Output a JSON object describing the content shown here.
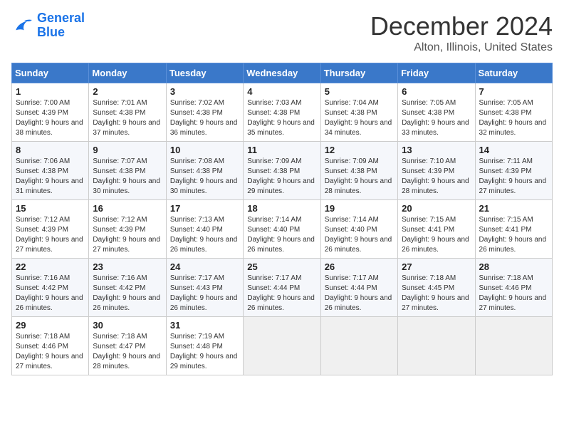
{
  "logo": {
    "line1": "General",
    "line2": "Blue"
  },
  "title": "December 2024",
  "location": "Alton, Illinois, United States",
  "days_header": [
    "Sunday",
    "Monday",
    "Tuesday",
    "Wednesday",
    "Thursday",
    "Friday",
    "Saturday"
  ],
  "weeks": [
    [
      {
        "day": 1,
        "sunrise": "7:00 AM",
        "sunset": "4:39 PM",
        "daylight": "9 hours and 38 minutes."
      },
      {
        "day": 2,
        "sunrise": "7:01 AM",
        "sunset": "4:38 PM",
        "daylight": "9 hours and 37 minutes."
      },
      {
        "day": 3,
        "sunrise": "7:02 AM",
        "sunset": "4:38 PM",
        "daylight": "9 hours and 36 minutes."
      },
      {
        "day": 4,
        "sunrise": "7:03 AM",
        "sunset": "4:38 PM",
        "daylight": "9 hours and 35 minutes."
      },
      {
        "day": 5,
        "sunrise": "7:04 AM",
        "sunset": "4:38 PM",
        "daylight": "9 hours and 34 minutes."
      },
      {
        "day": 6,
        "sunrise": "7:05 AM",
        "sunset": "4:38 PM",
        "daylight": "9 hours and 33 minutes."
      },
      {
        "day": 7,
        "sunrise": "7:05 AM",
        "sunset": "4:38 PM",
        "daylight": "9 hours and 32 minutes."
      }
    ],
    [
      {
        "day": 8,
        "sunrise": "7:06 AM",
        "sunset": "4:38 PM",
        "daylight": "9 hours and 31 minutes."
      },
      {
        "day": 9,
        "sunrise": "7:07 AM",
        "sunset": "4:38 PM",
        "daylight": "9 hours and 30 minutes."
      },
      {
        "day": 10,
        "sunrise": "7:08 AM",
        "sunset": "4:38 PM",
        "daylight": "9 hours and 30 minutes."
      },
      {
        "day": 11,
        "sunrise": "7:09 AM",
        "sunset": "4:38 PM",
        "daylight": "9 hours and 29 minutes."
      },
      {
        "day": 12,
        "sunrise": "7:09 AM",
        "sunset": "4:38 PM",
        "daylight": "9 hours and 28 minutes."
      },
      {
        "day": 13,
        "sunrise": "7:10 AM",
        "sunset": "4:39 PM",
        "daylight": "9 hours and 28 minutes."
      },
      {
        "day": 14,
        "sunrise": "7:11 AM",
        "sunset": "4:39 PM",
        "daylight": "9 hours and 27 minutes."
      }
    ],
    [
      {
        "day": 15,
        "sunrise": "7:12 AM",
        "sunset": "4:39 PM",
        "daylight": "9 hours and 27 minutes."
      },
      {
        "day": 16,
        "sunrise": "7:12 AM",
        "sunset": "4:39 PM",
        "daylight": "9 hours and 27 minutes."
      },
      {
        "day": 17,
        "sunrise": "7:13 AM",
        "sunset": "4:40 PM",
        "daylight": "9 hours and 26 minutes."
      },
      {
        "day": 18,
        "sunrise": "7:14 AM",
        "sunset": "4:40 PM",
        "daylight": "9 hours and 26 minutes."
      },
      {
        "day": 19,
        "sunrise": "7:14 AM",
        "sunset": "4:40 PM",
        "daylight": "9 hours and 26 minutes."
      },
      {
        "day": 20,
        "sunrise": "7:15 AM",
        "sunset": "4:41 PM",
        "daylight": "9 hours and 26 minutes."
      },
      {
        "day": 21,
        "sunrise": "7:15 AM",
        "sunset": "4:41 PM",
        "daylight": "9 hours and 26 minutes."
      }
    ],
    [
      {
        "day": 22,
        "sunrise": "7:16 AM",
        "sunset": "4:42 PM",
        "daylight": "9 hours and 26 minutes."
      },
      {
        "day": 23,
        "sunrise": "7:16 AM",
        "sunset": "4:42 PM",
        "daylight": "9 hours and 26 minutes."
      },
      {
        "day": 24,
        "sunrise": "7:17 AM",
        "sunset": "4:43 PM",
        "daylight": "9 hours and 26 minutes."
      },
      {
        "day": 25,
        "sunrise": "7:17 AM",
        "sunset": "4:44 PM",
        "daylight": "9 hours and 26 minutes."
      },
      {
        "day": 26,
        "sunrise": "7:17 AM",
        "sunset": "4:44 PM",
        "daylight": "9 hours and 26 minutes."
      },
      {
        "day": 27,
        "sunrise": "7:18 AM",
        "sunset": "4:45 PM",
        "daylight": "9 hours and 27 minutes."
      },
      {
        "day": 28,
        "sunrise": "7:18 AM",
        "sunset": "4:46 PM",
        "daylight": "9 hours and 27 minutes."
      }
    ],
    [
      {
        "day": 29,
        "sunrise": "7:18 AM",
        "sunset": "4:46 PM",
        "daylight": "9 hours and 27 minutes."
      },
      {
        "day": 30,
        "sunrise": "7:18 AM",
        "sunset": "4:47 PM",
        "daylight": "9 hours and 28 minutes."
      },
      {
        "day": 31,
        "sunrise": "7:19 AM",
        "sunset": "4:48 PM",
        "daylight": "9 hours and 29 minutes."
      },
      null,
      null,
      null,
      null
    ]
  ]
}
